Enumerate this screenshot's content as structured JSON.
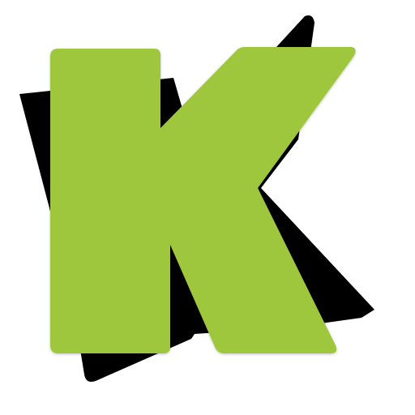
{
  "logo": {
    "letter": "K",
    "colors": {
      "letter_fill": "#9FC73C",
      "shadow_fill": "#000000",
      "background": "#FFFFFF"
    }
  }
}
